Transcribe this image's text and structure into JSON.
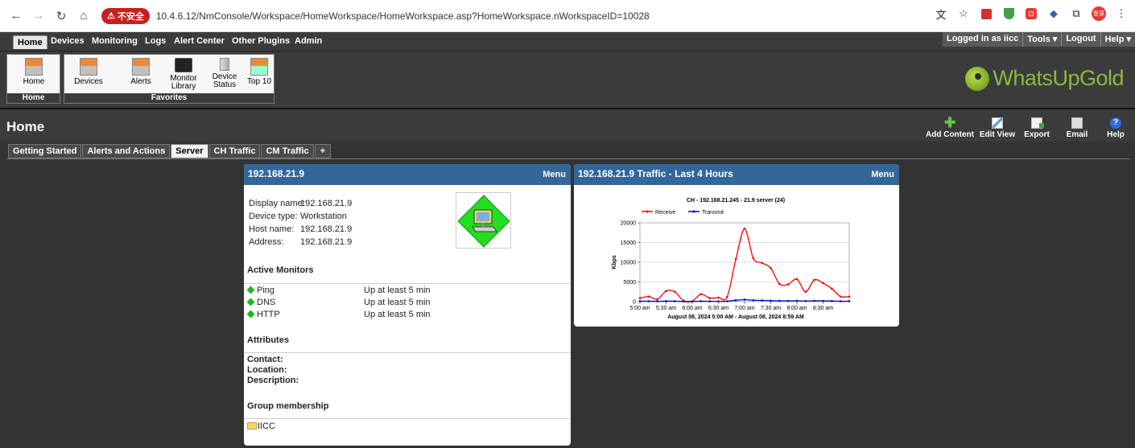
{
  "browser": {
    "security_label": "不安全",
    "url": "10.4.6.12/NmConsole/Workspace/HomeWorkspace/HomeWorkspace.asp?HomeWorkspace.nWorkspaceID=10028",
    "profile_initials": "登录"
  },
  "menu": {
    "items": [
      "Home",
      "Devices",
      "Monitoring",
      "Logs",
      "Alert Center",
      "Other Plugins",
      "Admin"
    ],
    "logged_in": "Logged in as iicc",
    "tools": "Tools ▾",
    "logout": "Logout",
    "help": "Help ▾"
  },
  "ribbon": {
    "home_group_label": "Home",
    "favorites_group_label": "Favorites",
    "items": [
      "Home",
      "Devices",
      "Alerts",
      "Monitor Library",
      "Device Status",
      "Top 10"
    ]
  },
  "logo": {
    "text": "WhatsUpGold"
  },
  "page": {
    "title": "Home",
    "actions": [
      "Add Content",
      "Edit View",
      "Export",
      "Email",
      "Help"
    ]
  },
  "tabs": [
    "Getting Started",
    "Alerts and Actions",
    "Server",
    "CH Traffic",
    "CM Traffic",
    "+"
  ],
  "device_panel": {
    "title": "192.168.21.9",
    "menu": "Menu",
    "fields": [
      {
        "label": "Display name:",
        "value": "192.168.21.9"
      },
      {
        "label": "Device type:",
        "value": "Workstation"
      },
      {
        "label": "Host name:",
        "value": "192.168.21.9"
      },
      {
        "label": "Address:",
        "value": "192.168.21.9"
      }
    ],
    "active_monitors_title": "Active Monitors",
    "monitors": [
      {
        "name": "Ping",
        "status": "Up at least 5 min"
      },
      {
        "name": "DNS",
        "status": "Up at least 5 min"
      },
      {
        "name": "HTTP",
        "status": "Up at least 5 min"
      }
    ],
    "attributes_title": "Attributes",
    "attributes": [
      "Contact:",
      "Location:",
      "Description:"
    ],
    "group_title": "Group membership",
    "group": "IICC"
  },
  "traffic_panel": {
    "title": "192.168.21.9 Traffic - Last 4 Hours",
    "menu": "Menu"
  },
  "chart_data": {
    "type": "line",
    "title": "CH - 192.168.21.245 - 21.9 server (24)",
    "ylabel": "Kbps",
    "xlabel": "August 08, 2024 5:00 AM - August 08, 2024 8:59 AM",
    "ylim": [
      0,
      20000
    ],
    "yticks": [
      0,
      5000,
      10000,
      15000,
      20000
    ],
    "x_tick_labels": [
      "5:00 am",
      "5:30 am",
      "6:00 am",
      "6:30 am",
      "7:00 am",
      "7:30 am",
      "8:00 am",
      "8:30 am"
    ],
    "x_minutes": [
      0,
      10,
      20,
      30,
      40,
      50,
      60,
      70,
      80,
      90,
      100,
      110,
      120,
      130,
      140,
      150,
      160,
      170,
      180,
      190,
      200,
      210,
      220,
      230,
      240
    ],
    "legend_position": "top-left",
    "series": [
      {
        "name": "Receive",
        "color": "#ff0000",
        "values": [
          900,
          1300,
          600,
          2700,
          2500,
          200,
          100,
          1900,
          900,
          1000,
          1200,
          10800,
          18500,
          11000,
          9800,
          8500,
          4500,
          4400,
          5700,
          2500,
          5500,
          4700,
          3300,
          1300,
          1300
        ]
      },
      {
        "name": "Transmit",
        "color": "#0000cc",
        "values": [
          100,
          100,
          80,
          120,
          100,
          60,
          50,
          100,
          80,
          90,
          90,
          350,
          500,
          350,
          300,
          250,
          200,
          180,
          200,
          150,
          200,
          180,
          150,
          100,
          100
        ]
      }
    ]
  }
}
